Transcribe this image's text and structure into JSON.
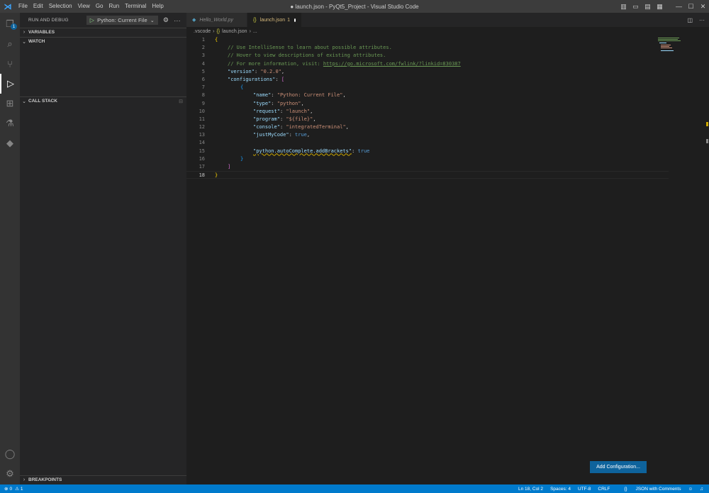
{
  "window": {
    "title": "● launch.json - PyQt5_Project - Visual Studio Code",
    "menu": [
      "File",
      "Edit",
      "Selection",
      "View",
      "Go",
      "Run",
      "Terminal",
      "Help"
    ]
  },
  "activity_bar": {
    "explorer_badge": "1"
  },
  "sidebar": {
    "header": "RUN AND DEBUG",
    "run_config": "Python: Current File",
    "sections": {
      "variables": "VARIABLES",
      "watch": "WATCH",
      "call_stack": "CALL STACK",
      "breakpoints": "BREAKPOINTS"
    }
  },
  "tabs": [
    {
      "label": "Hello_World.py",
      "icon": "python-file-icon"
    },
    {
      "label": "launch.json",
      "badge": "1",
      "icon": "json-file-icon",
      "dirty": true
    }
  ],
  "breadcrumb": {
    "folder": ".vscode",
    "file": "launch.json",
    "trail": "..."
  },
  "editor": {
    "line_numbers": [
      "1",
      "2",
      "3",
      "4",
      "5",
      "6",
      "7",
      "8",
      "9",
      "10",
      "11",
      "12",
      "13",
      "14",
      "15",
      "16",
      "17",
      "18"
    ],
    "lines": {
      "l1": "{",
      "l2": "// Use IntelliSense to learn about possible attributes.",
      "l3": "// Hover to view descriptions of existing attributes.",
      "l4_text": "// For more information, visit: ",
      "l4_url": "https://go.microsoft.com/fwlink/?linkid=830387",
      "l5_key": "\"version\"",
      "l5_val": "\"0.2.0\"",
      "l6_key": "\"configurations\"",
      "l6_open": "[",
      "l7": "{",
      "l8_key": "\"name\"",
      "l8_val": "\"Python: Current File\"",
      "l9_key": "\"type\"",
      "l9_val": "\"python\"",
      "l10_key": "\"request\"",
      "l10_val": "\"launch\"",
      "l11_key": "\"program\"",
      "l11_val": "\"${file}\"",
      "l12_key": "\"console\"",
      "l12_val": "\"integratedTerminal\"",
      "l13_key": "\"justMyCode\"",
      "l13_val": "true",
      "l15_key": "\"python.autoComplete.addBrackets\"",
      "l15_val": "true",
      "l16": "}",
      "l17": "]",
      "l18": "}"
    }
  },
  "add_configuration_button": "Add Configuration...",
  "status_bar": {
    "errors": "0",
    "warnings": "1",
    "cursor": "Ln 18, Col 2",
    "spaces": "Spaces: 4",
    "encoding": "UTF-8",
    "eol": "CRLF",
    "language": "JSON with Comments"
  },
  "colors": {
    "accent": "#007acc",
    "button": "#0e639c",
    "warning": "#cca700"
  }
}
